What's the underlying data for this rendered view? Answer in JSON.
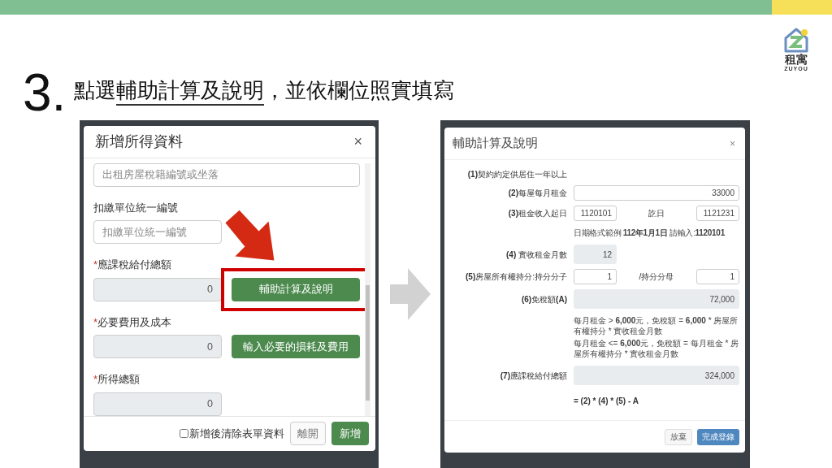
{
  "slide": {
    "step": "3.",
    "title_parts": [
      {
        "text": "點選",
        "underlined": false
      },
      {
        "text": "輔助計算及說明",
        "underlined": true
      },
      {
        "text": "，並依欄位照實填寫",
        "underlined": false
      }
    ],
    "logo": {
      "name": "租寓",
      "tagline": "ZUYOU"
    }
  },
  "left_dialog": {
    "title": "新增所得資料",
    "close": "×",
    "fields": [
      {
        "kind": "input",
        "placeholder": "出租房屋稅籍編號或坐落"
      },
      {
        "kind": "labeled",
        "label": "扣繳單位統一編號",
        "placeholder": "扣繳單位統一編號",
        "readonly": false
      },
      {
        "kind": "labeled",
        "label": "應課稅給付總額",
        "required_mark": "*",
        "value": "0",
        "readonly": true,
        "button": "輔助計算及說明",
        "highlighted": true
      },
      {
        "kind": "labeled",
        "label": "必要費用及成本",
        "required_mark": "*",
        "value": "0",
        "readonly": true,
        "button": "輸入必要的損耗及費用",
        "highlighted": false
      },
      {
        "kind": "labeled",
        "label": "所得總額",
        "required_mark": "*",
        "value": "0",
        "readonly": true
      }
    ],
    "checkbox": {
      "label": "新增後清除表單資料",
      "checked": false
    },
    "buttons": [
      {
        "label": "離開",
        "kind": "secondary"
      },
      {
        "label": "新增",
        "kind": "primary"
      }
    ]
  },
  "right_dialog": {
    "title": "輔助計算及說明",
    "close": "×",
    "rows": [
      {
        "kind": "note",
        "label": "**(1)**契約約定供居住一年以上"
      },
      {
        "kind": "input",
        "label": "**(2)**每屋每月租金",
        "value": "33000",
        "readonly": false
      },
      {
        "kind": "pair",
        "label": "**(3)**租金收入起日",
        "value": "1120101",
        "label_2": "訖日",
        "value_2": "1121231"
      },
      {
        "kind": "hint",
        "lines": [
          "日期格式範例 **112年1月1日** 請輸入:**1120101**"
        ]
      },
      {
        "kind": "short",
        "label": "**(4)** 實收租金月數",
        "value": "12",
        "readonly": true
      },
      {
        "kind": "pair",
        "label": "**(5)**房屋所有權持分:持分分子",
        "value": "1",
        "label_2": "/持分分母",
        "value_2": "1"
      },
      {
        "kind": "input",
        "label": "**(6)**免稅額**(A)**",
        "value": "72,000",
        "readonly": true
      },
      {
        "kind": "hint",
        "lines": [
          "每月租金 > **6,000**元，免稅額 = **6,000** * 房屋所有權持分 * 實收租金月數",
          "每月租金 <= **6,000**元，免稅額 = 每月租金 * 房屋所有權持分 * 實收租金月數"
        ]
      },
      {
        "kind": "input",
        "label": "**(7)**應課稅給付總額",
        "value": "324,000",
        "readonly": true
      },
      {
        "kind": "formula",
        "text": "= (2) * (4) * (5) - A"
      }
    ],
    "buttons": [
      {
        "label": "放棄",
        "kind": "secondary"
      },
      {
        "label": "完成登錄",
        "kind": "primary"
      }
    ]
  }
}
